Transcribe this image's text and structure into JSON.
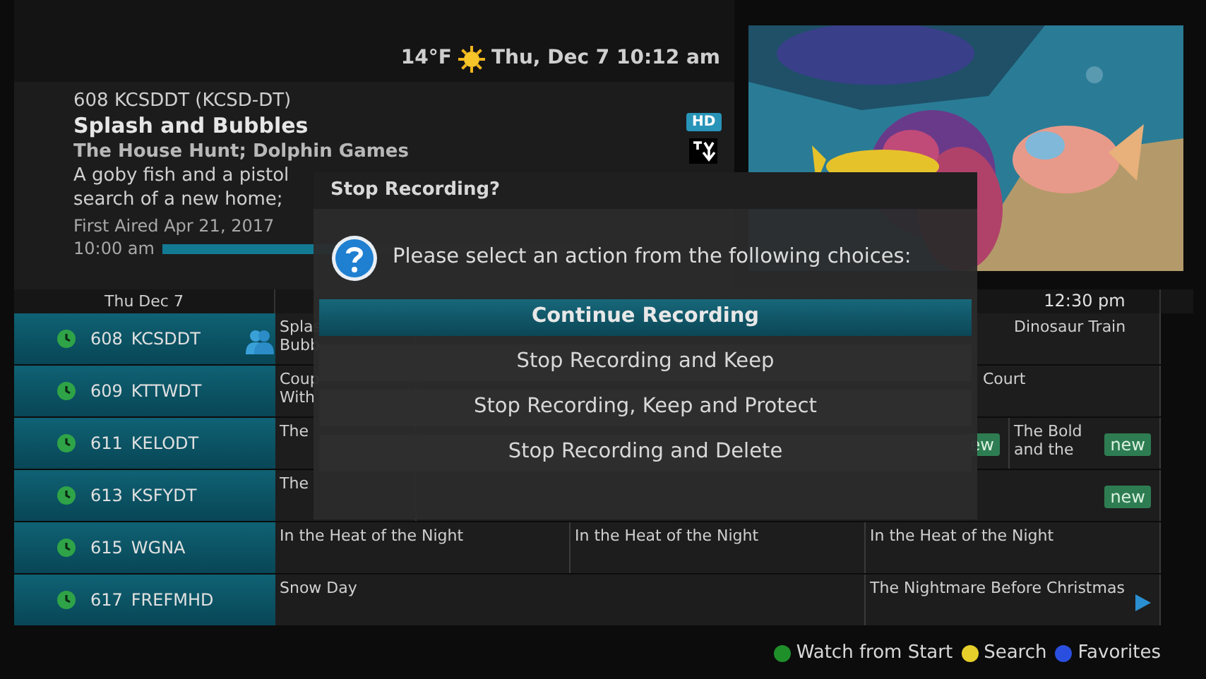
{
  "top_bar": {
    "temperature": "14°F",
    "datetime": "Thu, Dec 7 10:12 am"
  },
  "info": {
    "channel": "608 KCSDDT (KCSD-DT)",
    "title": "Splash and Bubbles",
    "episode": "The House Hunt; Dolphin Games",
    "description_lines": [
      "A goby fish and a pistol",
      "search of a new home;"
    ],
    "first_aired": "First Aired Apr 21, 2017",
    "start_time": "10:00 am",
    "level": 0.45,
    "badge": "HD"
  },
  "guide": {
    "date_header": "Thu Dec 7",
    "time_headers": [
      "12:30 pm"
    ],
    "channels": [
      {
        "number": "608",
        "name": "KCSDDT",
        "people_icon": true,
        "cells": [
          {
            "lines": [
              "Splas",
              "Bubb"
            ]
          },
          {
            "lines": [
              "Dinosaur Train"
            ]
          }
        ]
      },
      {
        "number": "609",
        "name": "KTTWDT",
        "people_icon": false,
        "cells": [
          {
            "lines": [
              "Coup",
              "With"
            ]
          },
          {
            "lines": [
              "Court"
            ]
          }
        ]
      },
      {
        "number": "611",
        "name": "KELODT",
        "people_icon": false,
        "cells": [
          {
            "lines": [
              "The"
            ]
          },
          {
            "badge": "ew"
          },
          {
            "lines": [
              "The Bold",
              "and the"
            ],
            "badge": "new"
          }
        ]
      },
      {
        "number": "613",
        "name": "KSFYDT",
        "people_icon": false,
        "cells": [
          {
            "lines": [
              "The"
            ]
          },
          {
            "badge": "new"
          }
        ]
      },
      {
        "number": "615",
        "name": "WGNA",
        "people_icon": false,
        "cells": [
          {
            "lines": [
              "In the Heat of the Night"
            ]
          },
          {
            "lines": [
              "In the Heat of the Night"
            ]
          },
          {
            "lines": [
              "In the Heat of the Night"
            ]
          }
        ]
      },
      {
        "number": "617",
        "name": "FREFMHD",
        "people_icon": false,
        "cells": [
          {
            "lines": [
              "Snow Day"
            ],
            "more_arrow": false
          },
          {
            "lines": [
              "The Nightmare Before Christmas"
            ],
            "more_arrow": true
          }
        ]
      }
    ]
  },
  "dialog": {
    "title": "Stop Recording?",
    "message": "Please select an action from the following choices:",
    "options": [
      {
        "label": "Continue Recording",
        "selected": true
      },
      {
        "label": "Stop Recording and Keep",
        "selected": false
      },
      {
        "label": "Stop Recording, Keep and Protect",
        "selected": false
      },
      {
        "label": "Stop Recording and Delete",
        "selected": false
      }
    ]
  },
  "footer": [
    {
      "label": "Watch from Start",
      "color": "#1f8f2a"
    },
    {
      "label": "Search",
      "color": "#e6cf2a"
    },
    {
      "label": "Favorites",
      "color": "#2a4fe0"
    }
  ]
}
